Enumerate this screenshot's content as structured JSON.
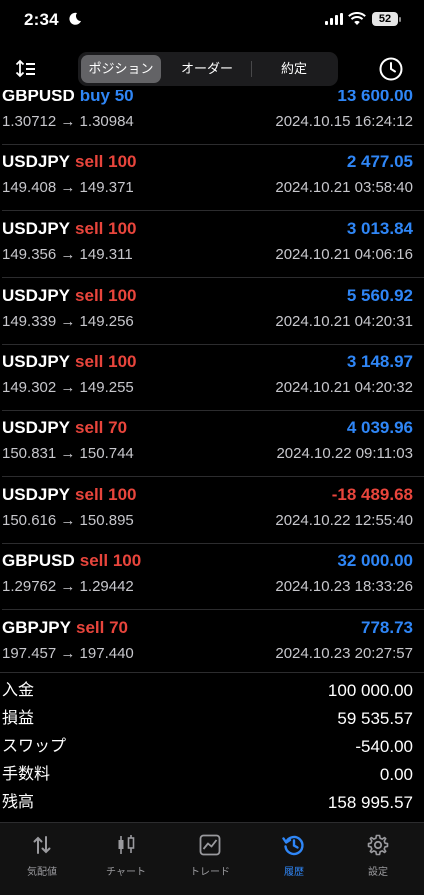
{
  "status": {
    "time": "2:34",
    "battery": "52"
  },
  "tabs": [
    {
      "label": "ポジション",
      "active": true
    },
    {
      "label": "オーダー",
      "active": false
    },
    {
      "label": "約定",
      "active": false
    }
  ],
  "rows": [
    {
      "symbol": "GBPUSD",
      "side": "buy",
      "volume": "50",
      "profit": "13 600.00",
      "prices": "1.30712 → 1.30984",
      "datetime": "2024.10.15 16:24:12"
    },
    {
      "symbol": "USDJPY",
      "side": "sell",
      "volume": "100",
      "profit": "2 477.05",
      "prices": "149.408 → 149.371",
      "datetime": "2024.10.21 03:58:40"
    },
    {
      "symbol": "USDJPY",
      "side": "sell",
      "volume": "100",
      "profit": "3 013.84",
      "prices": "149.356 → 149.311",
      "datetime": "2024.10.21 04:06:16"
    },
    {
      "symbol": "USDJPY",
      "side": "sell",
      "volume": "100",
      "profit": "5 560.92",
      "prices": "149.339 → 149.256",
      "datetime": "2024.10.21 04:20:31"
    },
    {
      "symbol": "USDJPY",
      "side": "sell",
      "volume": "100",
      "profit": "3 148.97",
      "prices": "149.302 → 149.255",
      "datetime": "2024.10.21 04:20:32"
    },
    {
      "symbol": "USDJPY",
      "side": "sell",
      "volume": "70",
      "profit": "4 039.96",
      "prices": "150.831 → 150.744",
      "datetime": "2024.10.22 09:11:03"
    },
    {
      "symbol": "USDJPY",
      "side": "sell",
      "volume": "100",
      "profit": "-18 489.68",
      "prices": "150.616 → 150.895",
      "datetime": "2024.10.22 12:55:40"
    },
    {
      "symbol": "GBPUSD",
      "side": "sell",
      "volume": "100",
      "profit": "32 000.00",
      "prices": "1.29762 → 1.29442",
      "datetime": "2024.10.23 18:33:26"
    },
    {
      "symbol": "GBPJPY",
      "side": "sell",
      "volume": "70",
      "profit": "778.73",
      "prices": "197.457 → 197.440",
      "datetime": "2024.10.23 20:27:57"
    }
  ],
  "summary": [
    {
      "label": "入金",
      "value": "100 000.00"
    },
    {
      "label": "損益",
      "value": "59 535.57"
    },
    {
      "label": "スワップ",
      "value": "-540.00"
    },
    {
      "label": "手数料",
      "value": "0.00"
    },
    {
      "label": "残高",
      "value": "158 995.57"
    }
  ],
  "bottom_tabs": [
    {
      "label": "気配値",
      "icon": "arrows-updown-icon",
      "active": false
    },
    {
      "label": "チャート",
      "icon": "candlestick-icon",
      "active": false
    },
    {
      "label": "トレード",
      "icon": "trade-chart-icon",
      "active": false
    },
    {
      "label": "履歴",
      "icon": "history-icon",
      "active": true
    },
    {
      "label": "設定",
      "icon": "gear-icon",
      "active": false
    }
  ],
  "colors": {
    "profit_positive": "#2f86f6",
    "profit_negative": "#e8453c",
    "sell": "#e8453c",
    "buy": "#2f86f6",
    "active_tab": "#2f86f6"
  }
}
